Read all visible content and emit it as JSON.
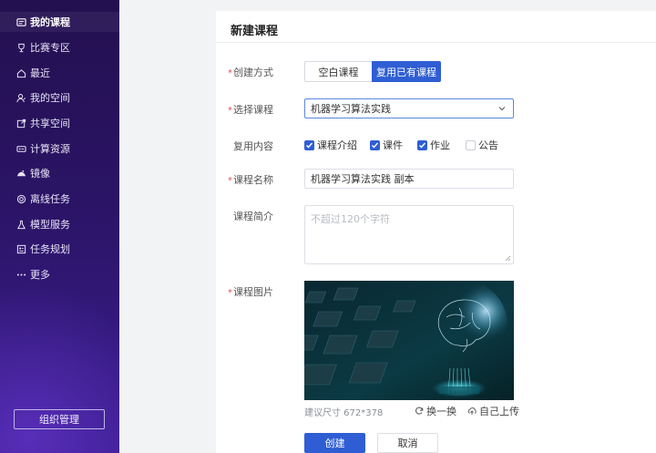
{
  "sidebar": {
    "items": [
      {
        "label": "我的课程",
        "icon": "course-icon"
      },
      {
        "label": "比赛专区",
        "icon": "trophy-icon"
      },
      {
        "label": "最近",
        "icon": "home-icon"
      },
      {
        "label": "我的空间",
        "icon": "user-icon"
      },
      {
        "label": "共享空间",
        "icon": "share-icon"
      },
      {
        "label": "计算资源",
        "icon": "compute-icon"
      },
      {
        "label": "镜像",
        "icon": "image-icon"
      },
      {
        "label": "离线任务",
        "icon": "offline-task-icon"
      },
      {
        "label": "模型服务",
        "icon": "flask-icon"
      },
      {
        "label": "任务规划",
        "icon": "plan-icon"
      },
      {
        "label": "更多",
        "icon": "more-icon"
      }
    ],
    "org_button": "组织管理"
  },
  "form": {
    "title": "新建课程",
    "create_method": {
      "label": "创建方式",
      "options": [
        "空白课程",
        "复用已有课程"
      ],
      "selected": "复用已有课程"
    },
    "select_course": {
      "label": "选择课程",
      "value": "机器学习算法实践"
    },
    "reuse_content": {
      "label": "复用内容",
      "options": [
        {
          "label": "课程介绍",
          "checked": true
        },
        {
          "label": "课件",
          "checked": true
        },
        {
          "label": "作业",
          "checked": true
        },
        {
          "label": "公告",
          "checked": false
        }
      ]
    },
    "course_name": {
      "label": "课程名称",
      "value": "机器学习算法实践 副本"
    },
    "course_intro": {
      "label": "课程简介",
      "placeholder": "不超过120个字符"
    },
    "course_image": {
      "label": "课程图片",
      "size_hint": "建议尺寸 672*378",
      "swap_label": "换一换",
      "upload_label": "自己上传"
    },
    "submit_label": "创建",
    "cancel_label": "取消"
  },
  "colors": {
    "primary": "#2f5ed4",
    "required": "#e34d4d",
    "sidebar_top": "#23104f",
    "sidebar_bottom": "#3b1d8f"
  }
}
